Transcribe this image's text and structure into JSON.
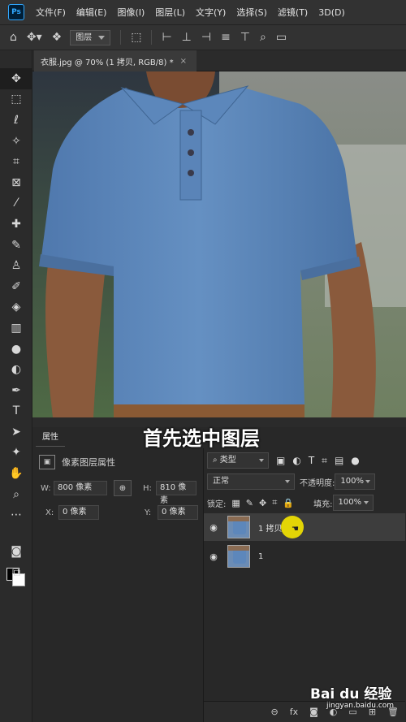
{
  "app": {
    "logo": "Ps"
  },
  "menubar": {
    "items": [
      "文件(F)",
      "编辑(E)",
      "图像(I)",
      "图层(L)",
      "文字(Y)",
      "选择(S)",
      "滤镜(T)",
      "3D(D)"
    ]
  },
  "options_bar": {
    "auto_select_target": "图层"
  },
  "document": {
    "tab_title": "衣服.jpg @ 70% (1 拷贝, RGB/8) *",
    "close_glyph": "×"
  },
  "tools": [
    "move-icon",
    "marquee-icon",
    "lasso-icon",
    "magic-wand-icon",
    "crop-icon",
    "frame-icon",
    "eyedropper-icon",
    "spot-heal-icon",
    "brush-icon",
    "stamp-icon",
    "history-brush-icon",
    "eraser-icon",
    "gradient-icon",
    "blur-icon",
    "dodge-icon",
    "pen-icon",
    "type-icon",
    "path-select-icon",
    "shape-icon",
    "hand-icon",
    "zoom-icon"
  ],
  "caption": "首先选中图层",
  "properties": {
    "tab": "属性",
    "header": "像素图层属性",
    "w_label": "W:",
    "w_value": "800 像素",
    "h_label": "H:",
    "h_value": "810 像素",
    "x_label": "X:",
    "x_value": "0 像素",
    "y_label": "Y:",
    "y_value": "0 像素",
    "link_glyph": "⊕"
  },
  "layers": {
    "filter_kind": "类型",
    "blend_mode": "正常",
    "opacity_label": "不透明度:",
    "opacity_value": "100%",
    "lock_label": "锁定:",
    "fill_label": "填充:",
    "fill_value": "100%",
    "items": [
      {
        "name": "1 拷贝",
        "selected": true,
        "visible": true
      },
      {
        "name": "1",
        "selected": false,
        "visible": true
      }
    ],
    "bottom_fx": "fx"
  },
  "watermark": {
    "brand": "Bai du 经验",
    "url": "jingyan.baidu.com"
  },
  "colors": {
    "accent": "#31a8ff",
    "cursor_highlight": "#f5e600",
    "shirt": "#5d87bb"
  }
}
